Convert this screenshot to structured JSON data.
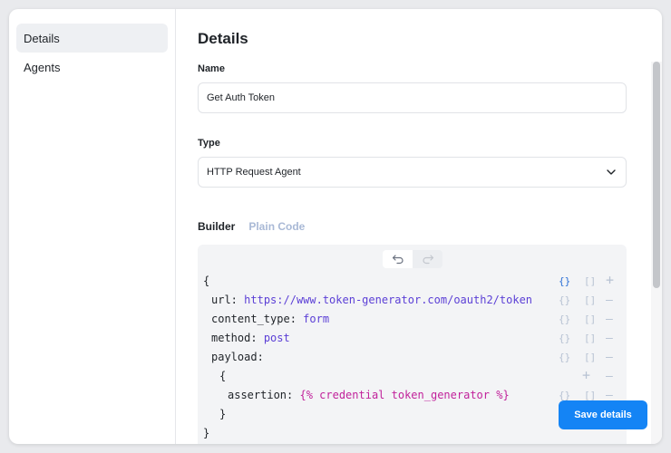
{
  "sidebar": {
    "items": [
      {
        "label": "Details",
        "active": true
      },
      {
        "label": "Agents",
        "active": false
      }
    ]
  },
  "main": {
    "title": "Details",
    "name_label": "Name",
    "name_value": "Get Auth Token",
    "type_label": "Type",
    "type_value": "HTTP Request Agent",
    "tabs": {
      "builder": "Builder",
      "plain_code": "Plain Code"
    }
  },
  "editor": {
    "lines": {
      "open_brace": "{",
      "url_key": "url:",
      "url_value": "https://www.token-generator.com/oauth2/token",
      "content_type_key": "content_type:",
      "content_type_value": "form",
      "method_key": "method:",
      "method_value": "post",
      "payload_key": "payload:",
      "payload_open": "{",
      "assertion_key": "assertion:",
      "assertion_value": "{% credential token_generator %}",
      "payload_close": "}",
      "close_brace": "}"
    },
    "controls": {
      "object": "{}",
      "array": "[]",
      "add": "+",
      "remove": "—"
    }
  },
  "actions": {
    "save_label": "Save details"
  },
  "colors": {
    "accent": "#1484f5",
    "value": "#5b3fd6",
    "template": "#c1229b",
    "inactive_tab": "#a9b9d6"
  }
}
